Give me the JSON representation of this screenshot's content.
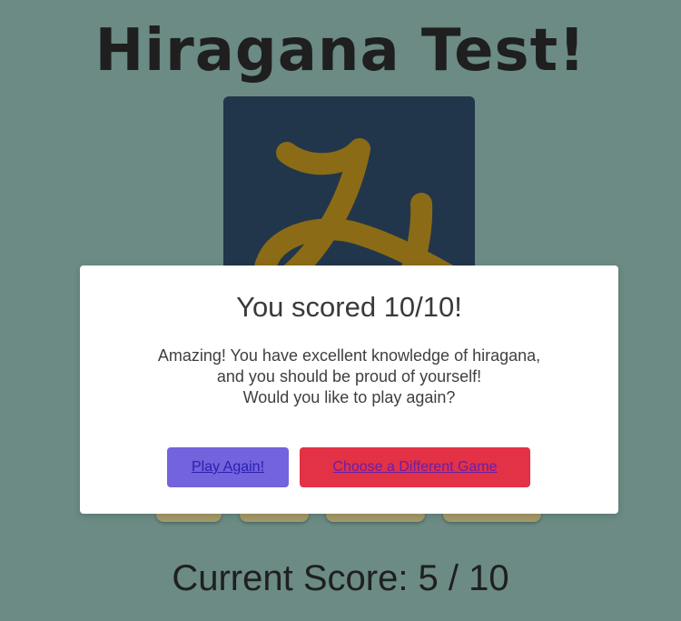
{
  "page": {
    "title": "Hiragana Test!",
    "current_score_label": "Current Score: 5 / 10"
  },
  "card": {
    "character": "み",
    "background_color": "#21364a",
    "character_color": "#8b6b16"
  },
  "answers": {
    "count": 4
  },
  "modal": {
    "title": "You scored 10/10!",
    "message_line1": "Amazing! You have excellent knowledge of hiragana,",
    "message_line2": "and you should be proud of yourself!",
    "message_line3": "Would you like to play again?",
    "play_again_label": "Play Again!",
    "choose_game_label": "Choose a Different Game"
  },
  "colors": {
    "page_background": "#6b8b84",
    "play_again_button": "#7363dc",
    "choose_game_button": "#e33146",
    "answer_button": "#a39a6a"
  }
}
